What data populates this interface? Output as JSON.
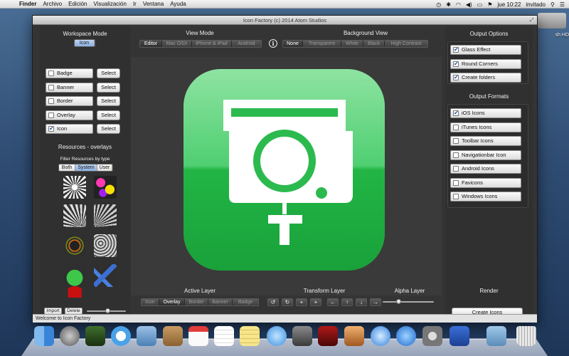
{
  "menubar": {
    "app": "Finder",
    "menus": [
      "Archivo",
      "Edición",
      "Visualización",
      "Ir",
      "Ventana",
      "Ayuda"
    ],
    "clock": "jue 10:22",
    "user": "invitado"
  },
  "desktop": {
    "hd_label": "sh HD"
  },
  "window": {
    "title": "Icon Factory (c) 2014 Atom Studios",
    "status": "Welcome to Icon Factory"
  },
  "workspace": {
    "title": "Workspace Mode",
    "mode": "Icon",
    "layers": [
      {
        "label": "Badge",
        "checked": false,
        "select": "Select"
      },
      {
        "label": "Banner",
        "checked": false,
        "select": "Select"
      },
      {
        "label": "Border",
        "checked": false,
        "select": "Select"
      },
      {
        "label": "Overlay",
        "checked": false,
        "select": "Select"
      },
      {
        "label": "Icon",
        "checked": true,
        "select": "Select"
      }
    ]
  },
  "resources": {
    "title": "Resources - overlays",
    "filter_label": "Filter Resources by type",
    "filters": [
      "Both",
      "System",
      "User"
    ],
    "active_filter": "System",
    "import_label": "Import",
    "delete_label": "Delete",
    "thumb_size_level": 0.55
  },
  "view_mode": {
    "title": "View Mode",
    "options": [
      "Editor",
      "Mac OSX",
      "iPhone & iPad",
      "Android"
    ],
    "active": "Editor"
  },
  "background_view": {
    "title": "Background View",
    "options": [
      "None",
      "Transparent",
      "White",
      "Black",
      "High Contrast"
    ],
    "active": "None"
  },
  "output_options": {
    "title": "Output Options",
    "items": [
      {
        "label": "Glass Effect",
        "checked": true
      },
      {
        "label": "Round Corners",
        "checked": true
      },
      {
        "label": "Create folders",
        "checked": true
      }
    ]
  },
  "output_formats": {
    "title": "Output Formats",
    "items": [
      {
        "label": "iOS Icons",
        "checked": true
      },
      {
        "label": "iTunes Icons",
        "checked": false
      },
      {
        "label": "Toolbar Icons",
        "checked": false
      },
      {
        "label": "Navigationbar Icon",
        "checked": false
      },
      {
        "label": "Android Icons",
        "checked": false
      },
      {
        "label": "Favicons",
        "checked": false
      },
      {
        "label": "Windows Icons",
        "checked": false
      }
    ]
  },
  "active_layer": {
    "title": "Active Layer",
    "options": [
      "Icon",
      "Overlay",
      "Border",
      "Banner",
      "Badge"
    ],
    "active": "Overlay"
  },
  "transform": {
    "title": "Transform Layer",
    "buttons": [
      {
        "name": "rotate-left-icon",
        "glyph": "↺"
      },
      {
        "name": "rotate-right-icon",
        "glyph": "↻"
      },
      {
        "name": "zoom-in-icon",
        "glyph": "+"
      },
      {
        "name": "zoom-in-alt-icon",
        "glyph": "+"
      },
      {
        "name": "move-left-icon",
        "glyph": "←"
      },
      {
        "name": "move-up-icon",
        "glyph": "↑"
      },
      {
        "name": "move-down-icon",
        "glyph": "↓"
      },
      {
        "name": "move-right-icon",
        "glyph": "→"
      }
    ]
  },
  "alpha": {
    "title": "Alpha Layer",
    "level": 0.3
  },
  "render": {
    "title": "Render",
    "button": "Create Icons"
  },
  "colors": {
    "icon_green_top": "#7fdc94",
    "icon_green_bottom": "#1aa83c",
    "accent_check": "#2752a8"
  }
}
